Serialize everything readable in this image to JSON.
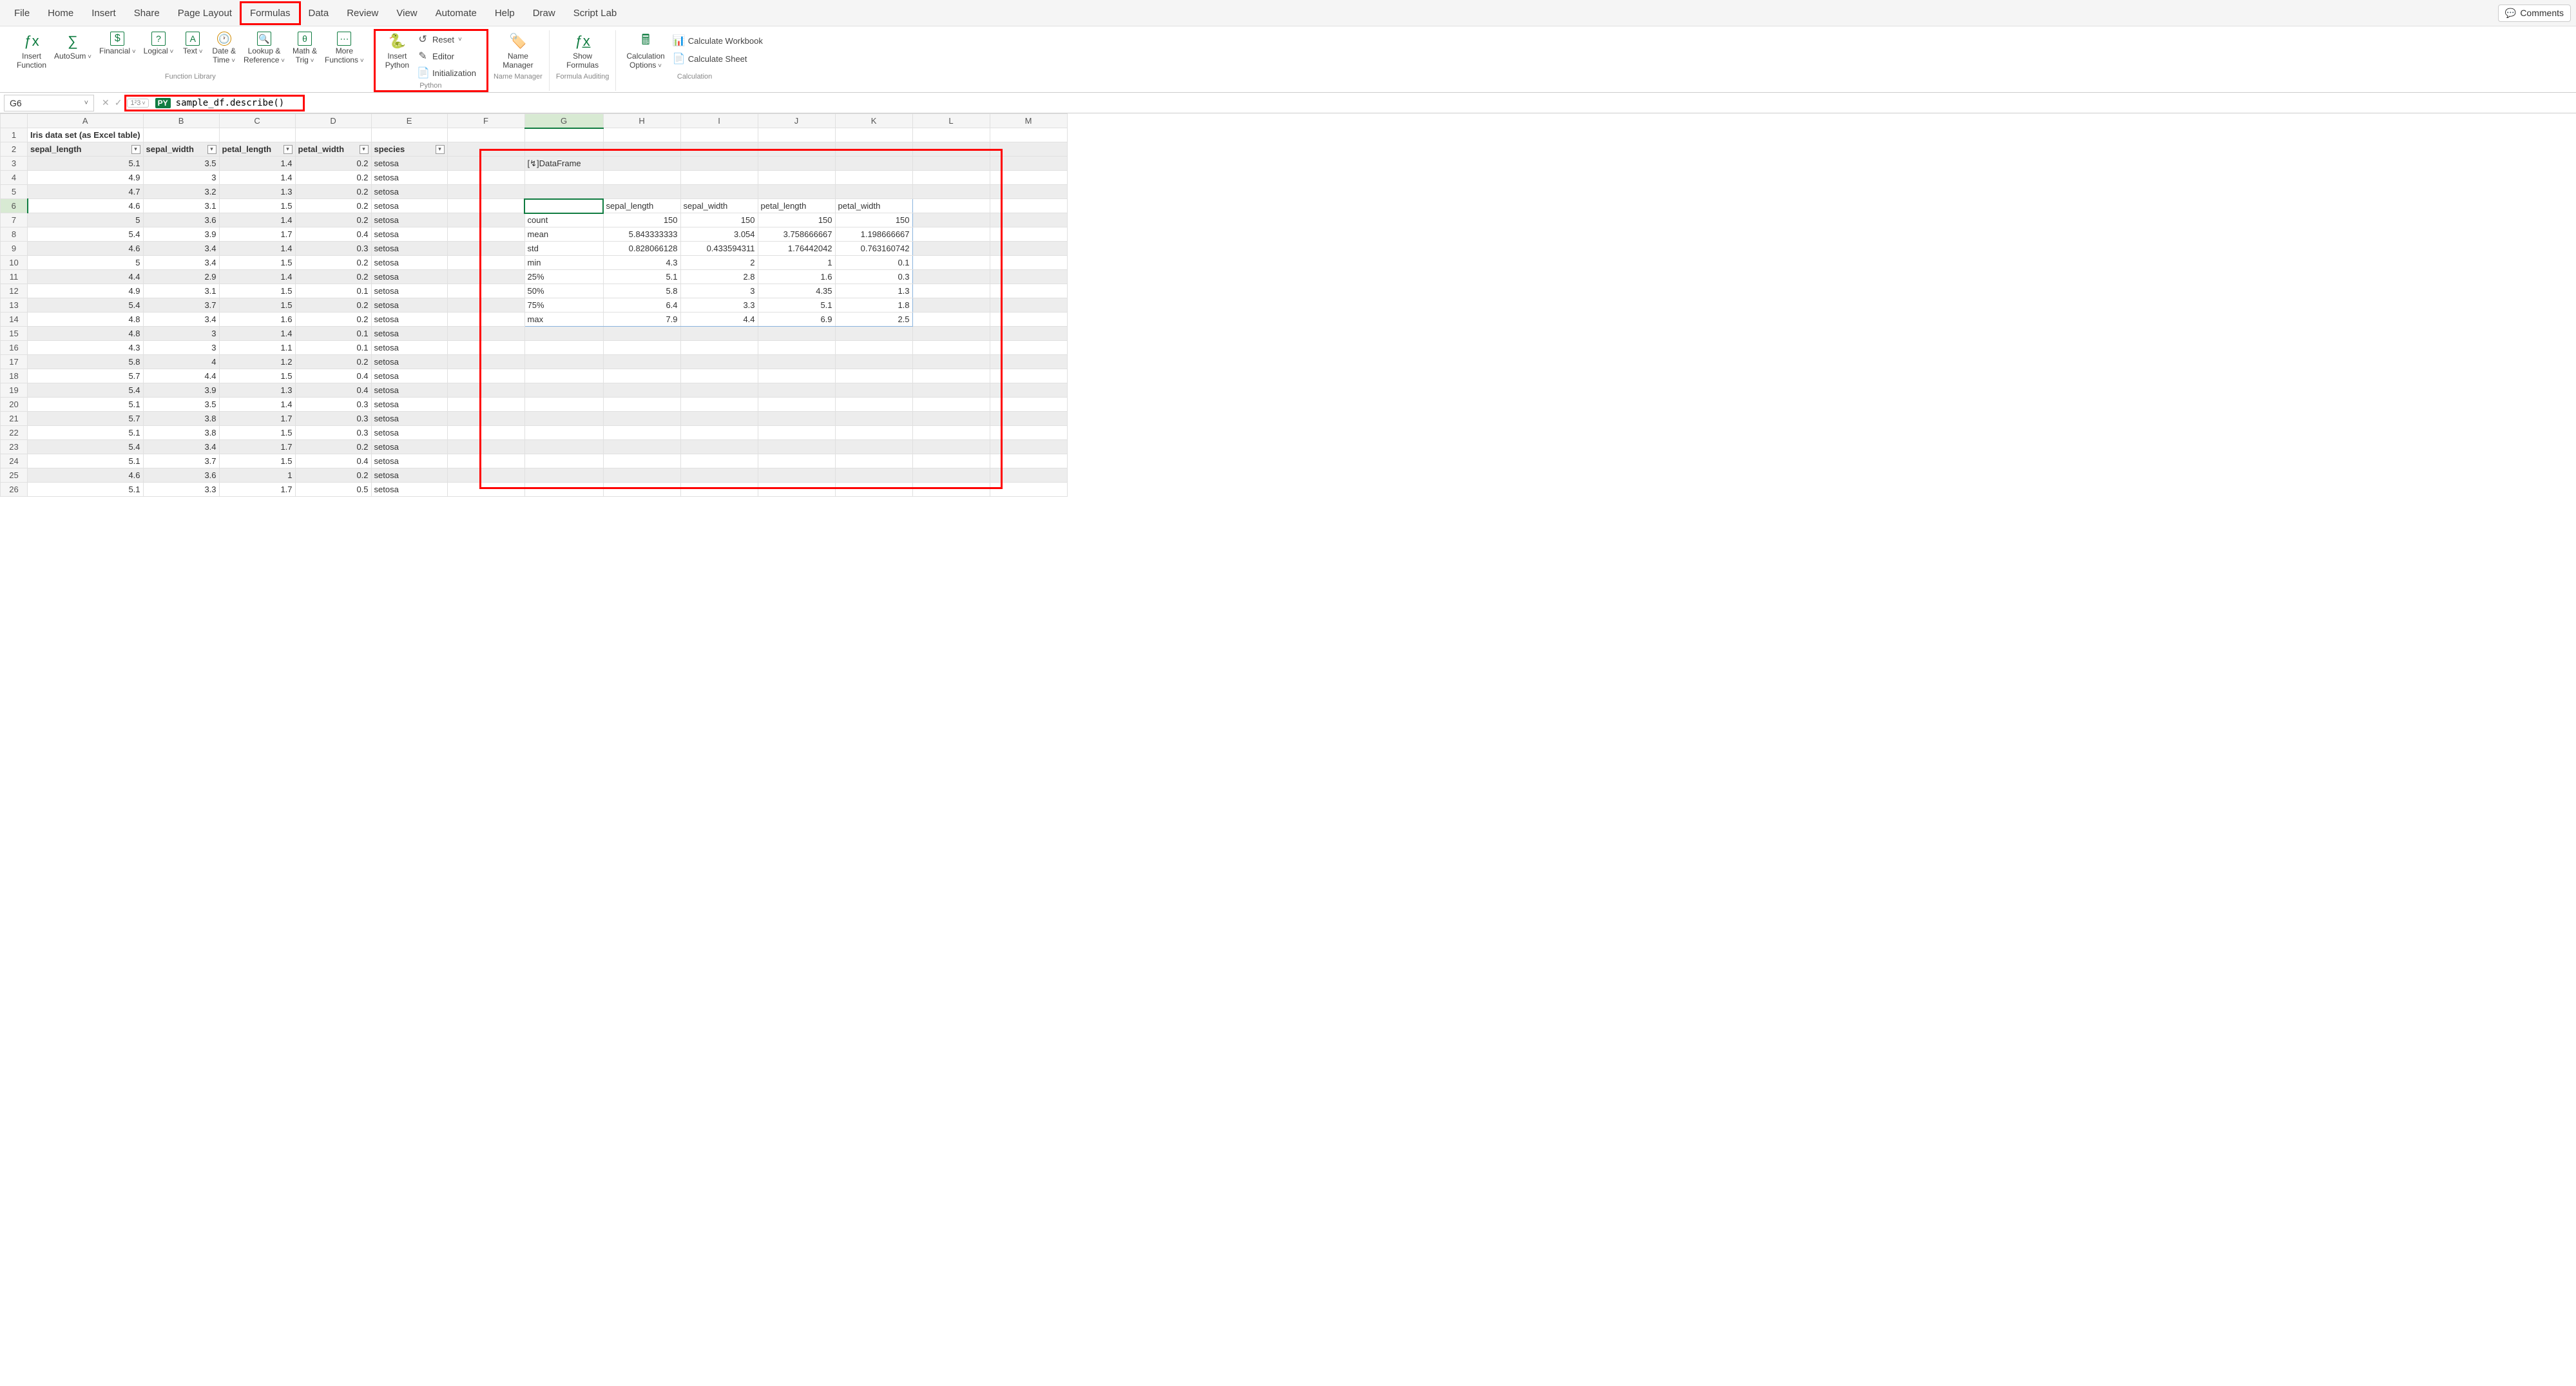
{
  "tabs": [
    "File",
    "Home",
    "Insert",
    "Share",
    "Page Layout",
    "Formulas",
    "Data",
    "Review",
    "View",
    "Automate",
    "Help",
    "Draw",
    "Script Lab"
  ],
  "active_tab": "Formulas",
  "comments_label": "Comments",
  "ribbon": {
    "function_library": {
      "insert_function": "Insert\nFunction",
      "autosum": "AutoSum",
      "financial": "Financial",
      "logical": "Logical",
      "text": "Text",
      "date_time": "Date &\nTime",
      "lookup_ref": "Lookup &\nReference",
      "math_trig": "Math &\nTrig",
      "more_functions": "More\nFunctions",
      "group_label": "Function Library"
    },
    "python": {
      "insert_python": "Insert\nPython",
      "reset": "Reset",
      "editor": "Editor",
      "initialization": "Initialization",
      "group_label": "Python"
    },
    "name_manager": {
      "btn": "Name\nManager",
      "group_label": "Name Manager"
    },
    "formula_auditing": {
      "show_formulas": "Show\nFormulas",
      "group_label": "Formula Auditing"
    },
    "calculation": {
      "calc_options": "Calculation\nOptions",
      "calc_workbook": "Calculate Workbook",
      "calc_sheet": "Calculate Sheet",
      "group_label": "Calculation"
    }
  },
  "formula_bar": {
    "namebox": "G6",
    "py_badge": "PY",
    "formula": "sample_df.describe()",
    "mode_hint": "1²3"
  },
  "columns": [
    "A",
    "B",
    "C",
    "D",
    "E",
    "F",
    "G",
    "H",
    "I",
    "J",
    "K",
    "L",
    "M"
  ],
  "sheet": {
    "title_cell": "Iris data set (as Excel table)",
    "headers": [
      "sepal_length",
      "sepal_width",
      "petal_length",
      "petal_width",
      "species"
    ],
    "rows": [
      [
        5.1,
        3.5,
        1.4,
        0.2,
        "setosa"
      ],
      [
        4.9,
        3,
        1.4,
        0.2,
        "setosa"
      ],
      [
        4.7,
        3.2,
        1.3,
        0.2,
        "setosa"
      ],
      [
        4.6,
        3.1,
        1.5,
        0.2,
        "setosa"
      ],
      [
        5,
        3.6,
        1.4,
        0.2,
        "setosa"
      ],
      [
        5.4,
        3.9,
        1.7,
        0.4,
        "setosa"
      ],
      [
        4.6,
        3.4,
        1.4,
        0.3,
        "setosa"
      ],
      [
        5,
        3.4,
        1.5,
        0.2,
        "setosa"
      ],
      [
        4.4,
        2.9,
        1.4,
        0.2,
        "setosa"
      ],
      [
        4.9,
        3.1,
        1.5,
        0.1,
        "setosa"
      ],
      [
        5.4,
        3.7,
        1.5,
        0.2,
        "setosa"
      ],
      [
        4.8,
        3.4,
        1.6,
        0.2,
        "setosa"
      ],
      [
        4.8,
        3,
        1.4,
        0.1,
        "setosa"
      ],
      [
        4.3,
        3,
        1.1,
        0.1,
        "setosa"
      ],
      [
        5.8,
        4,
        1.2,
        0.2,
        "setosa"
      ],
      [
        5.7,
        4.4,
        1.5,
        0.4,
        "setosa"
      ],
      [
        5.4,
        3.9,
        1.3,
        0.4,
        "setosa"
      ],
      [
        5.1,
        3.5,
        1.4,
        0.3,
        "setosa"
      ],
      [
        5.7,
        3.8,
        1.7,
        0.3,
        "setosa"
      ],
      [
        5.1,
        3.8,
        1.5,
        0.3,
        "setosa"
      ],
      [
        5.4,
        3.4,
        1.7,
        0.2,
        "setosa"
      ],
      [
        5.1,
        3.7,
        1.5,
        0.4,
        "setosa"
      ],
      [
        4.6,
        3.6,
        1,
        0.2,
        "setosa"
      ],
      [
        5.1,
        3.3,
        1.7,
        0.5,
        "setosa"
      ]
    ]
  },
  "dataframe_label": "[↯]DataFrame",
  "describe": {
    "columns": [
      "",
      "sepal_length",
      "sepal_width",
      "petal_length",
      "petal_width"
    ],
    "rows": [
      [
        "count",
        150,
        150,
        150,
        150
      ],
      [
        "mean",
        5.843333333,
        3.054,
        3.758666667,
        1.198666667
      ],
      [
        "std",
        0.828066128,
        0.433594311,
        1.76442042,
        0.763160742
      ],
      [
        "min",
        4.3,
        2,
        1,
        0.1
      ],
      [
        "25%",
        5.1,
        2.8,
        1.6,
        0.3
      ],
      [
        "50%",
        5.8,
        3,
        4.35,
        1.3
      ],
      [
        "75%",
        6.4,
        3.3,
        5.1,
        1.8
      ],
      [
        "max",
        7.9,
        4.4,
        6.9,
        2.5
      ]
    ]
  },
  "selected_cell": "G6"
}
